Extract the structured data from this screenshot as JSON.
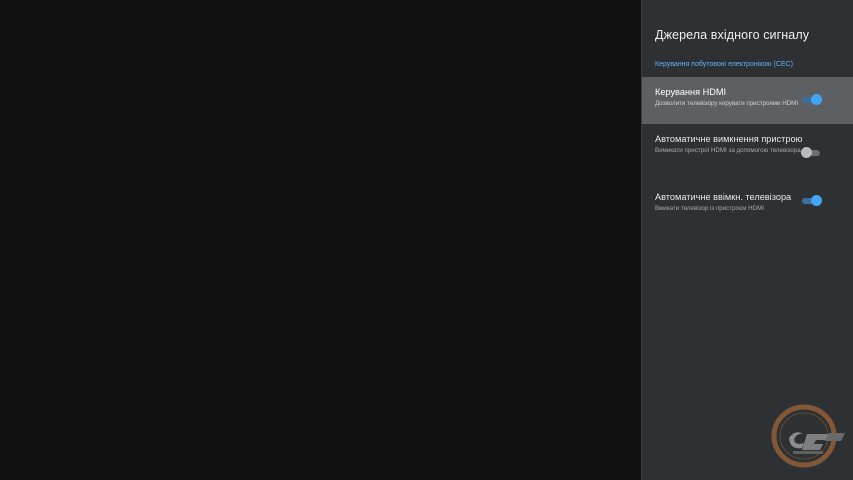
{
  "panel": {
    "title": "Джерела вхідного сигналу",
    "section_header": "Керування побутовою електронікою (CEC)"
  },
  "items": [
    {
      "title": "Керування HDMI",
      "summary": "Дозволити телевізору керувати пристроями HDMI",
      "switch_state": "on",
      "focused": true
    },
    {
      "title": "Автоматичне вимкнення пристрою",
      "summary": "Вимикати пристрої HDMI за допомогою телевізора",
      "switch_state": "off",
      "focused": false
    },
    {
      "title": "Автоматичне ввімкн. телевізора",
      "summary": "Вмикати телевізор із пристроєм HDMI",
      "switch_state": "on",
      "focused": false
    }
  ],
  "colors": {
    "accent": "#42a5f5",
    "panel_bg": "#2e3133",
    "focused_bg": "#5d6063",
    "screen_bg": "#111111"
  },
  "watermark": {
    "icon": "site-logo-watermark"
  }
}
